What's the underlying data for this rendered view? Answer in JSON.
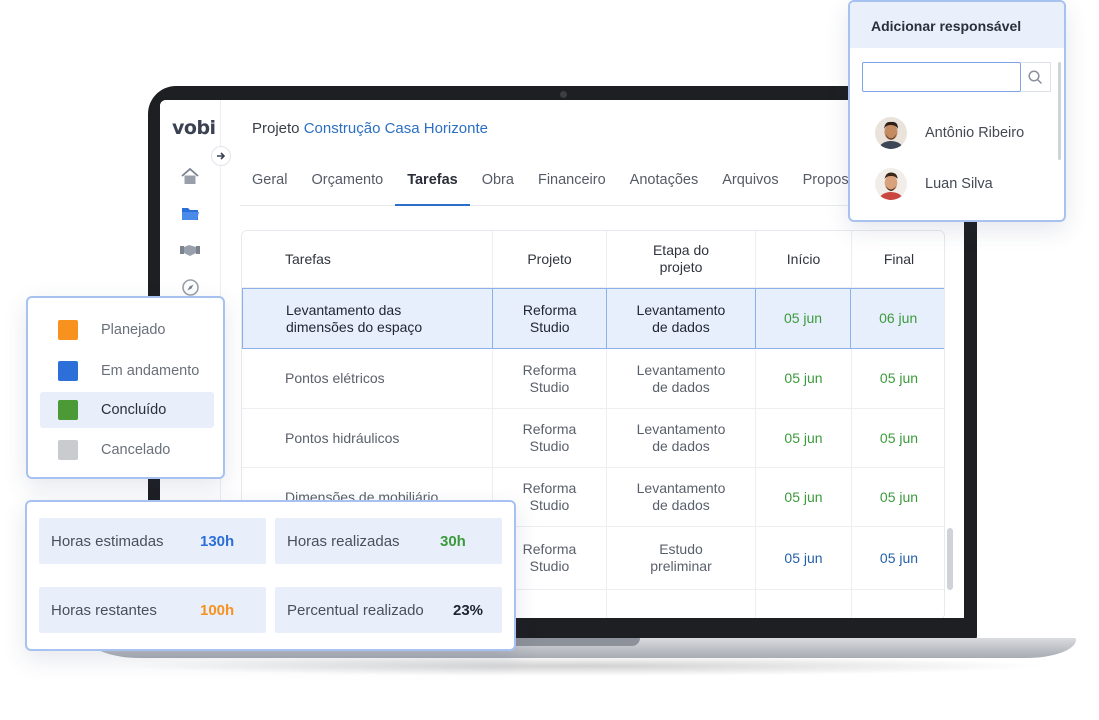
{
  "app": {
    "logo": "vobi",
    "project_prefix": "Projeto",
    "project_name": "Construção Casa Horizonte"
  },
  "tabs": [
    {
      "label": "Geral"
    },
    {
      "label": "Orçamento"
    },
    {
      "label": "Tarefas",
      "active": true
    },
    {
      "label": "Obra"
    },
    {
      "label": "Financeiro"
    },
    {
      "label": "Anotações"
    },
    {
      "label": "Arquivos"
    },
    {
      "label": "Propost"
    }
  ],
  "sidebar_icons": [
    "home-icon",
    "folder-icon",
    "handshake-icon",
    "compass-icon"
  ],
  "table": {
    "headers": [
      "Tarefas",
      "Projeto",
      "Etapa do projeto",
      "Início",
      "Final"
    ],
    "rows": [
      {
        "task": "Levantamento das dimensões do espaço",
        "project": "Reforma Studio",
        "stage": "Levantamento de dados",
        "start": "05 jun",
        "end": "06 jun",
        "highlighted": true
      },
      {
        "task": "Pontos elétricos",
        "project": "Reforma Studio",
        "stage": "Levantamento de dados",
        "start": "05 jun",
        "end": "05 jun"
      },
      {
        "task": "Pontos hidráulicos",
        "project": "Reforma Studio",
        "stage": "Levantamento de dados",
        "start": "05 jun",
        "end": "05 jun"
      },
      {
        "task": "Dimensões de mobiliário",
        "project": "Reforma Studio",
        "stage": "Levantamento de dados",
        "start": "05 jun",
        "end": "05 jun"
      },
      {
        "task": "",
        "project": "Reforma Studio",
        "stage": "Estudo preliminar",
        "start": "05 jun",
        "end": "05 jun"
      }
    ]
  },
  "responsible_panel": {
    "title": "Adicionar responsável",
    "search_value": "",
    "people": [
      {
        "name": "Antônio Ribeiro"
      },
      {
        "name": "Luan Silva"
      }
    ]
  },
  "status_panel": {
    "items": [
      {
        "label": "Planejado",
        "color": "#f7921e"
      },
      {
        "label": "Em andamento",
        "color": "#2c6fd8"
      },
      {
        "label": "Concluído",
        "color": "#4b9a36",
        "selected": true
      },
      {
        "label": "Cancelado",
        "color": "#c9cbcf"
      }
    ]
  },
  "hours_panel": {
    "estimated_label": "Horas estimadas",
    "estimated_value": "130h",
    "done_label": "Horas realizadas",
    "done_value": "30h",
    "remaining_label": "Horas restantes",
    "remaining_value": "100h",
    "percent_label": "Percentual realizado",
    "percent_value": "23%",
    "colors": {
      "estimated": "#2c6fd8",
      "done": "#3c9a3c",
      "remaining": "#f7921e",
      "percent": "#1f2430"
    }
  }
}
